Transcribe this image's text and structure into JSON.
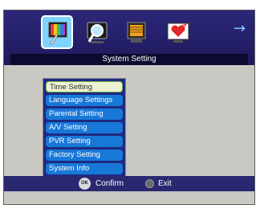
{
  "top_icons": [
    "picture-settings-icon",
    "search-channel-icon",
    "system-settings-icon",
    "favorites-icon"
  ],
  "arrow_icon": "→",
  "header": {
    "title": "System Setting"
  },
  "menu": {
    "items": [
      {
        "label": "Time Setting",
        "selected": true
      },
      {
        "label": "Language Settings"
      },
      {
        "label": "Parental Setting"
      },
      {
        "label": "A/V Setting"
      },
      {
        "label": "PVR Setting"
      },
      {
        "label": "Factory Setting"
      },
      {
        "label": "System Info"
      }
    ]
  },
  "footer": {
    "ok_button_label": "OK",
    "confirm_label": "Confirm",
    "exit_label": "Exit"
  },
  "colors": {
    "header_bg": "#2c2778",
    "menu_item": "#1878d8",
    "selected_item": "#eef2d2",
    "background": "#c9c8c3"
  }
}
